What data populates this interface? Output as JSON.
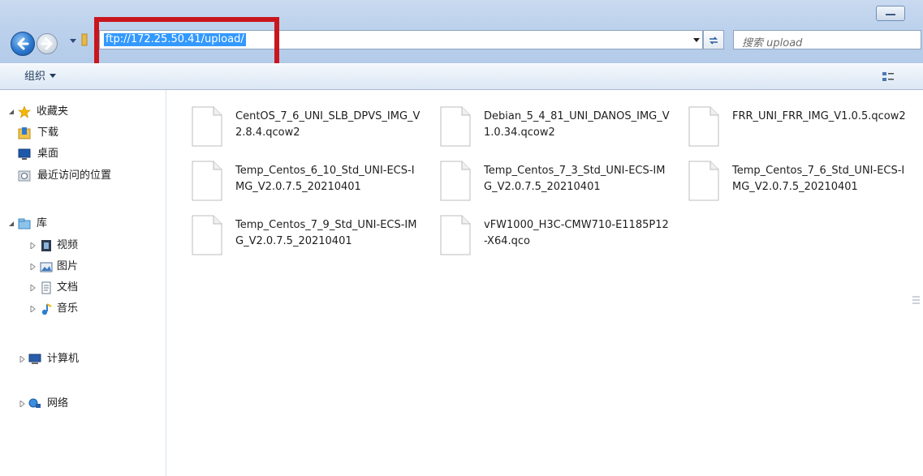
{
  "window": {
    "address": "ftp://172.25.50.41/upload/",
    "search_placeholder": "搜索 upload"
  },
  "toolbar": {
    "organize_label": "组织"
  },
  "sidebar": {
    "favorites": {
      "label": "收藏夹",
      "items": [
        {
          "label": "下载",
          "icon": "download-folder-icon"
        },
        {
          "label": "桌面",
          "icon": "desktop-icon"
        },
        {
          "label": "最近访问的位置",
          "icon": "recent-places-icon"
        }
      ]
    },
    "libraries": {
      "label": "库",
      "items": [
        {
          "label": "视频",
          "icon": "video-library-icon"
        },
        {
          "label": "图片",
          "icon": "pictures-library-icon"
        },
        {
          "label": "文档",
          "icon": "documents-library-icon"
        },
        {
          "label": "音乐",
          "icon": "music-library-icon"
        }
      ]
    },
    "computer": {
      "label": "计算机"
    },
    "network": {
      "label": "网络"
    }
  },
  "files": [
    {
      "name": "CentOS_7_6_UNI_SLB_DPVS_IMG_V2.8.4.qcow2"
    },
    {
      "name": "Debian_5_4_81_UNI_DANOS_IMG_V1.0.34.qcow2"
    },
    {
      "name": "FRR_UNI_FRR_IMG_V1.0.5.qcow2"
    },
    {
      "name": "Temp_Centos_6_10_Std_UNI-ECS-IMG_V2.0.7.5_20210401"
    },
    {
      "name": "Temp_Centos_7_3_Std_UNI-ECS-IMG_V2.0.7.5_20210401"
    },
    {
      "name": "Temp_Centos_7_6_Std_UNI-ECS-IMG_V2.0.7.5_20210401"
    },
    {
      "name": "Temp_Centos_7_9_Std_UNI-ECS-IMG_V2.0.7.5_20210401"
    },
    {
      "name": "vFW1000_H3C-CMW710-E1185P12-X64.qco"
    }
  ],
  "colors": {
    "highlight_box": "#c9161c",
    "address_selection": "#3399ff"
  }
}
